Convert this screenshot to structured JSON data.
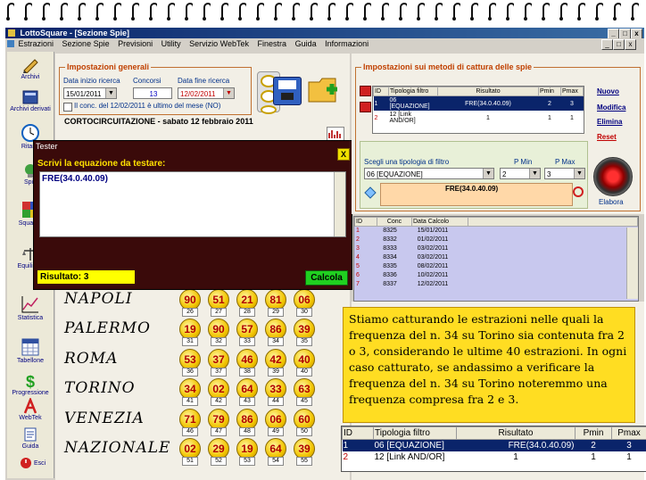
{
  "window": {
    "title": "LottoSquare - [Sezione Spie]",
    "controls": [
      "_",
      "□",
      "x"
    ],
    "inner_controls": [
      "_",
      "□",
      "x"
    ]
  },
  "menu": [
    "Estrazioni",
    "Sezione Spie",
    "Previsioni",
    "Utility",
    "Servizio WebTek",
    "Finestra",
    "Guida",
    "Informazioni"
  ],
  "sidebar": [
    {
      "label": "Archivi",
      "icon": "pencil-icon"
    },
    {
      "label": "Archivi derivati",
      "icon": "book-icon"
    },
    {
      "label": "Ritardi",
      "icon": "clock-icon"
    },
    {
      "label": "Spie",
      "icon": "lightbulb-icon"
    },
    {
      "label": "Squadre",
      "icon": "squares-icon"
    },
    {
      "label": "Equilibrio",
      "icon": "scale-icon"
    },
    {
      "label": "Statistica",
      "icon": "graph-icon"
    },
    {
      "label": "Tabellone",
      "icon": "calendar-icon"
    },
    {
      "label": "Progressione",
      "icon": "dollar-icon"
    },
    {
      "label": "WebTek",
      "icon": "webtek-icon"
    },
    {
      "label": "Guida",
      "icon": "guide-icon"
    },
    {
      "label": "Esci",
      "icon": "exit-icon"
    }
  ],
  "general": {
    "title": "Impostazioni generali",
    "start_label": "Data inizio ricerca",
    "start_value": "15/01/2011",
    "conc_label": "Concorsi",
    "conc_value": "13",
    "end_label": "Data fine ricerca",
    "end_value": "12/02/2011",
    "checkbox_label": "Il conc. del 12/02/2011 è ultimo del mese (NO)"
  },
  "draw_header": "CORTOCIRCUITAZIONE - sabato 12 febbraio 2011",
  "methods": {
    "title": "Impostazioni sui metodi di cattura delle spie",
    "columns": [
      "ID",
      "Tipologia filtro",
      "Risultato",
      "Pmin",
      "Pmax"
    ],
    "rows": [
      [
        "1",
        "06 [EQUAZIONE]",
        "FRE(34.0.40.09)",
        "2",
        "3"
      ],
      [
        "2",
        "12 [Link AND/OR]",
        "1",
        "1",
        "1"
      ]
    ],
    "links": [
      "Nuovo",
      "Modifica",
      "Elimina",
      "Reset"
    ],
    "choose_label": "Scegli una tipologia di filtro",
    "pmin_label": "P Min",
    "pmax_label": "P Max",
    "filter_value": "06 [EQUAZIONE]",
    "pmin_value": "2",
    "pmax_value": "3",
    "expr_value": "FRE(34.0.40.09)",
    "elabora_label": "Elabora"
  },
  "captured": {
    "columns": [
      "ID",
      "Conc",
      "Data Calcolo"
    ],
    "rows": [
      [
        "1",
        "8325",
        "15/01/2011"
      ],
      [
        "2",
        "8332",
        "01/02/2011"
      ],
      [
        "3",
        "8333",
        "03/02/2011"
      ],
      [
        "4",
        "8334",
        "03/02/2011"
      ],
      [
        "5",
        "8335",
        "08/02/2011"
      ],
      [
        "6",
        "8336",
        "10/02/2011"
      ],
      [
        "7",
        "8337",
        "12/02/2011"
      ]
    ]
  },
  "tester": {
    "title": "Tester",
    "close": "X",
    "prompt": "Scrivi la equazione da testare:",
    "equation": "FRE(34.0.40.09)",
    "result": "Risultato: 3",
    "button": "Calcola"
  },
  "wheels": [
    {
      "name": "NAPOLI",
      "numbers": [
        "90",
        "51",
        "21",
        "81",
        "06"
      ],
      "positions": [
        "26",
        "27",
        "28",
        "29",
        "30"
      ]
    },
    {
      "name": "PALERMO",
      "numbers": [
        "19",
        "90",
        "57",
        "86",
        "39"
      ],
      "positions": [
        "31",
        "32",
        "33",
        "34",
        "35"
      ]
    },
    {
      "name": "ROMA",
      "numbers": [
        "53",
        "37",
        "46",
        "42",
        "40"
      ],
      "positions": [
        "36",
        "37",
        "38",
        "39",
        "40"
      ]
    },
    {
      "name": "TORINO",
      "numbers": [
        "34",
        "02",
        "64",
        "33",
        "63"
      ],
      "positions": [
        "41",
        "42",
        "43",
        "44",
        "45"
      ]
    },
    {
      "name": "VENEZIA",
      "numbers": [
        "71",
        "79",
        "86",
        "06",
        "60"
      ],
      "positions": [
        "46",
        "47",
        "48",
        "49",
        "50"
      ]
    },
    {
      "name": "NAZIONALE",
      "numbers": [
        "02",
        "29",
        "19",
        "64",
        "39"
      ],
      "positions": [
        "51",
        "52",
        "53",
        "54",
        "55"
      ]
    }
  ],
  "note": "Stiamo catturando le estrazioni nelle quali la frequenza del n. 34 su Torino sia contenuta fra 2 o 3, considerando le ultime 40 estrazioni. In ogni caso catturato, se andassimo a verificare la frequenza del n. 34 su Torino noteremmo una frequenza compresa fra 2 e 3.",
  "zoom_table": {
    "columns": [
      "ID",
      "Tipologia filtro",
      "Risultato",
      "Pmin",
      "Pmax"
    ],
    "rows": [
      [
        "1",
        "06 [EQUAZIONE]",
        "FRE(34.0.40.09)",
        "2",
        "3"
      ],
      [
        "2",
        "12 [Link AND/OR]",
        "1",
        "1",
        "1"
      ]
    ]
  }
}
